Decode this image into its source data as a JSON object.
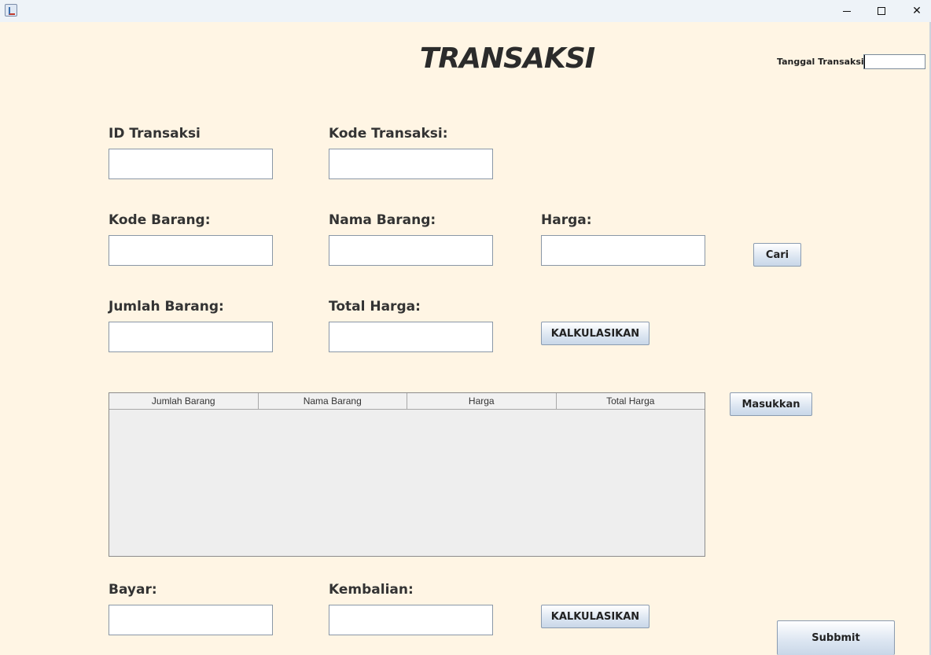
{
  "window": {
    "minimize": "—",
    "maximize": "☐",
    "close": "✕"
  },
  "title": "TRANSAKSI",
  "tanggal": {
    "label": "Tanggal Transaksi:",
    "value": ""
  },
  "fields": {
    "id_transaksi": {
      "label": "ID Transaksi",
      "value": ""
    },
    "kode_transaksi": {
      "label": "Kode Transaksi:",
      "value": ""
    },
    "kode_barang": {
      "label": "Kode Barang:",
      "value": ""
    },
    "nama_barang": {
      "label": "Nama Barang:",
      "value": ""
    },
    "harga": {
      "label": "Harga:",
      "value": ""
    },
    "jumlah_barang": {
      "label": "Jumlah Barang:",
      "value": ""
    },
    "total_harga": {
      "label": "Total Harga:",
      "value": ""
    },
    "bayar": {
      "label": "Bayar:",
      "value": ""
    },
    "kembalian": {
      "label": "Kembalian:",
      "value": ""
    }
  },
  "buttons": {
    "cari": "Cari",
    "kalkulasikan_total": "KALKULASIKAN",
    "masukkan": "Masukkan",
    "kalkulasikan_kembalian": "KALKULASIKAN",
    "submit": "Subbmit"
  },
  "table": {
    "columns": [
      "Jumlah Barang",
      "Nama Barang",
      "Harga",
      "Total Harga"
    ],
    "rows": []
  }
}
